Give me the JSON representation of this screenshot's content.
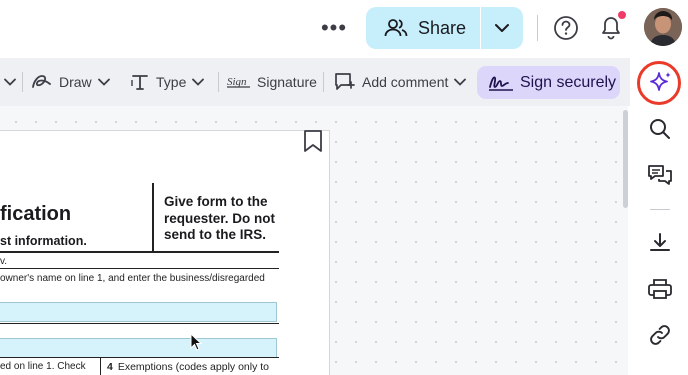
{
  "header": {
    "more_glyph": "•••",
    "share_label": "Share",
    "icons": [
      "people-icon",
      "chevron-down-icon",
      "help-icon",
      "bell-icon"
    ],
    "notification_dot_color": "#ef3b66"
  },
  "toolbar": {
    "draw_label": "Draw",
    "type_label": "Type",
    "signature_label": "Signature",
    "add_comment_label": "Add comment",
    "sign_securely_label": "Sign securely",
    "sign_accent": "#ddd6fb"
  },
  "document": {
    "title_fragment": "fication",
    "subtitle_fragment": "st information.",
    "give_form_text": "Give form to the requester. Do not send to the IRS.",
    "line_fragment_1": "v.",
    "line_fragment_2": "owner's name on line 1, and enter the business/disregarded",
    "line_fragment_3": "ed on line 1. Check",
    "exemptions_number": "4",
    "exemptions_text": "Exemptions (codes apply only to"
  },
  "right_rail": {
    "items": [
      "sparkle-ai-icon",
      "search-icon",
      "comments-icon",
      "download-icon",
      "print-icon",
      "link-icon"
    ],
    "highlight_color": "#ea3a2a"
  }
}
